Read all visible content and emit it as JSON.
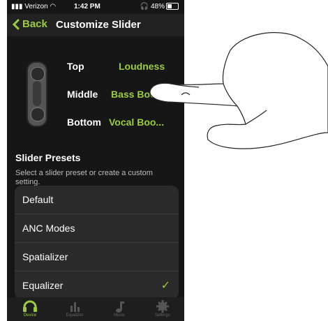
{
  "status": {
    "carrier": "Verizon",
    "time": "1:42 PM",
    "battery": "48%"
  },
  "nav": {
    "back_label": "Back",
    "title": "Customize Slider"
  },
  "slider_config": [
    {
      "position": "Top",
      "value": "Loudness"
    },
    {
      "position": "Middle",
      "value": "Bass Boost"
    },
    {
      "position": "Bottom",
      "value": "Vocal Boo..."
    }
  ],
  "presets": {
    "title": "Slider Presets",
    "description": "Select a slider preset or create a custom setting.",
    "items": [
      {
        "label": "Default"
      },
      {
        "label": "ANC Modes"
      },
      {
        "label": "Spatializer"
      },
      {
        "label": "Equalizer",
        "selected": true
      }
    ]
  },
  "tabs": [
    {
      "label": "Device",
      "icon": "headphones-icon",
      "active": true
    },
    {
      "label": "Equalizer",
      "icon": "equalizer-icon"
    },
    {
      "label": "Music",
      "icon": "music-note-icon"
    },
    {
      "label": "Settings",
      "icon": "gear-icon"
    }
  ],
  "colors": {
    "accent": "#9ccc3c",
    "background": "#161616",
    "card": "#2b2b2b"
  }
}
